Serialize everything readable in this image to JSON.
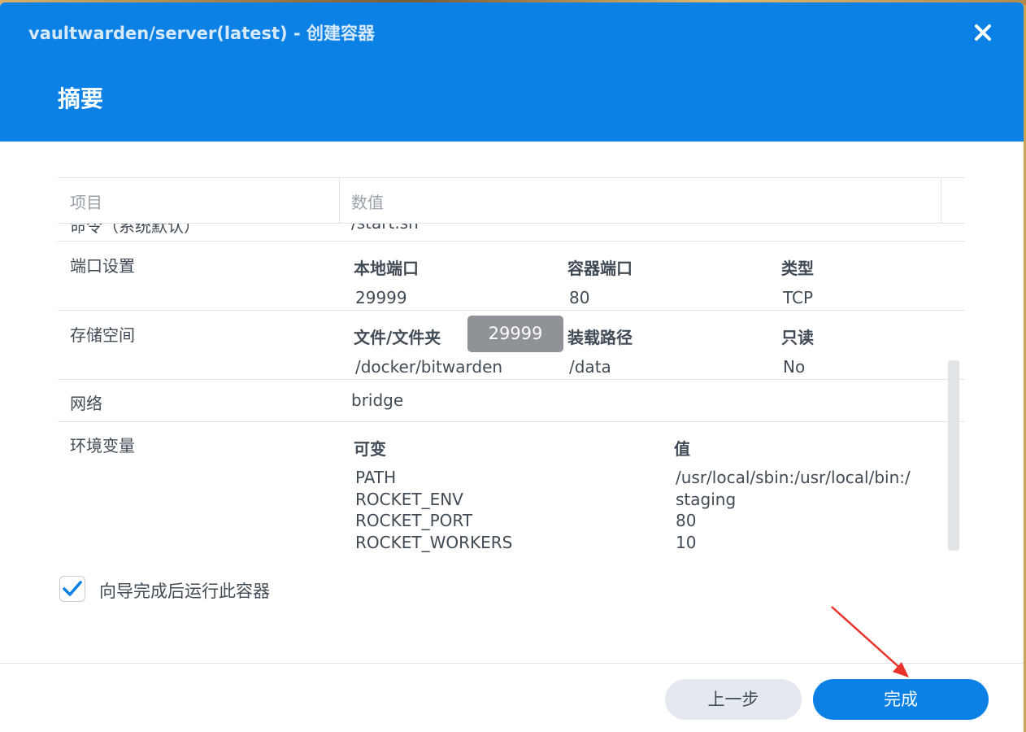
{
  "window": {
    "title": "vaultwarden/server(latest) - 创建容器"
  },
  "page": {
    "heading": "摘要"
  },
  "table": {
    "columns": [
      "项目",
      "数值"
    ],
    "clipped_row": {
      "label": "命令（系统默认）",
      "value": "/start.sh"
    },
    "ports": {
      "label": "端口设置",
      "headers": [
        "本地端口",
        "容器端口",
        "类型"
      ],
      "values": [
        "29999",
        "80",
        "TCP"
      ]
    },
    "storage": {
      "label": "存储空间",
      "headers": [
        "文件/文件夹",
        "装载路径",
        "只读"
      ],
      "values": [
        "/docker/bitwarden",
        "/data",
        "No"
      ]
    },
    "network": {
      "label": "网络",
      "value": "bridge"
    },
    "env": {
      "label": "环境变量",
      "headers": [
        "可变",
        "值"
      ],
      "rows": [
        {
          "name": "PATH",
          "value": "/usr/local/sbin:/usr/local/bin:/"
        },
        {
          "name": "ROCKET_ENV",
          "value": "staging"
        },
        {
          "name": "ROCKET_PORT",
          "value": "80"
        },
        {
          "name": "ROCKET_WORKERS",
          "value": "10"
        }
      ]
    }
  },
  "tooltip": {
    "text": "29999"
  },
  "run_after_wizard": {
    "label": "向导完成后运行此容器",
    "checked": true
  },
  "buttons": {
    "prev": "上一步",
    "done": "完成"
  },
  "colors": {
    "accent": "#0b81e6",
    "annotation_arrow": "#e8322a"
  },
  "icons": {
    "close": "close-icon",
    "check": "check-icon"
  }
}
